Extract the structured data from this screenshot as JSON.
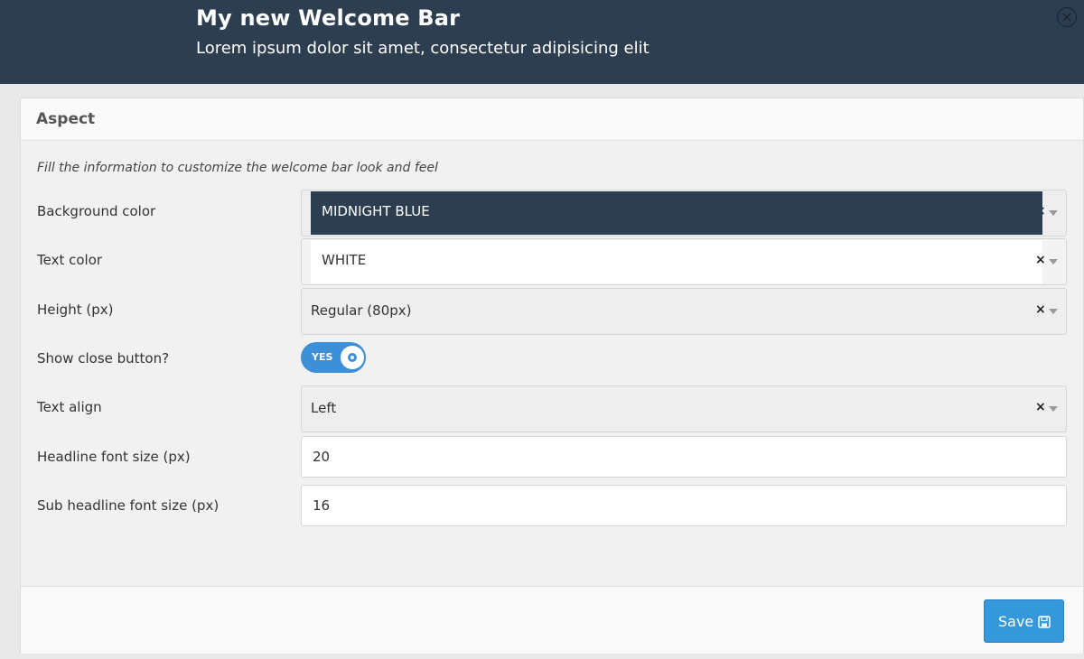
{
  "welcome_bar": {
    "headline": "My new Welcome Bar",
    "sub_headline": "Lorem ipsum dolor sit amet, consectetur adipisicing elit",
    "close_icon": "close-circle-icon",
    "background": "#2c3e50"
  },
  "panel": {
    "title": "Aspect",
    "intro": "Fill the information to customize the welcome bar look and feel"
  },
  "fields": {
    "background_color": {
      "label": "Background color",
      "value": "MIDNIGHT BLUE",
      "swatch": "#2c3e50"
    },
    "text_color": {
      "label": "Text color",
      "value": "WHITE",
      "swatch": "#ffffff"
    },
    "height": {
      "label": "Height (px)",
      "value": "Regular (80px)"
    },
    "show_close": {
      "label": "Show close button?",
      "toggle_text": "YES",
      "state": "on"
    },
    "text_align": {
      "label": "Text align",
      "value": "Left"
    },
    "headline_font_size": {
      "label": "Headline font size (px)",
      "value": "20"
    },
    "sub_headline_font_size": {
      "label": "Sub headline font size (px)",
      "value": "16"
    }
  },
  "clear_glyph": "×",
  "footer": {
    "save_label": "Save",
    "save_icon": "floppy-disk-icon",
    "accent": "#3498db"
  }
}
